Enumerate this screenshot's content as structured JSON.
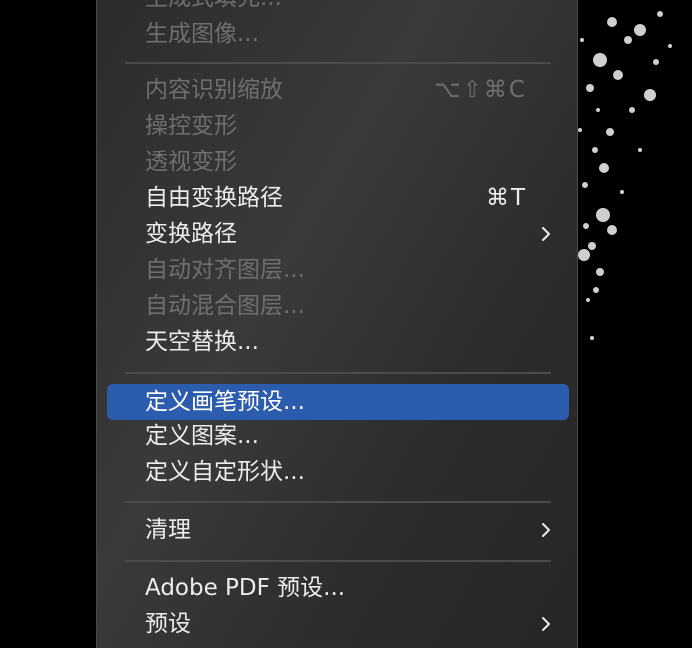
{
  "menu": {
    "items": [
      {
        "label": "生成式填充...",
        "disabled": true
      },
      {
        "label": "生成图像...",
        "disabled": true
      },
      {
        "label": "内容识别缩放",
        "shortcut": "⌥⇧⌘C",
        "disabled": true
      },
      {
        "label": "操控变形",
        "disabled": true
      },
      {
        "label": "透视变形",
        "disabled": true
      },
      {
        "label": "自由变换路径",
        "shortcut": "⌘T",
        "disabled": false
      },
      {
        "label": "变换路径",
        "submenu": true,
        "disabled": false
      },
      {
        "label": "自动对齐图层...",
        "disabled": true
      },
      {
        "label": "自动混合图层...",
        "disabled": true
      },
      {
        "label": "天空替换...",
        "disabled": false
      },
      {
        "label": "定义画笔预设...",
        "disabled": false,
        "selected": true
      },
      {
        "label": "定义图案...",
        "disabled": false
      },
      {
        "label": "定义自定形状...",
        "disabled": false
      },
      {
        "label": "清理",
        "submenu": true,
        "disabled": false
      },
      {
        "label": "Adobe PDF 预设...",
        "disabled": false
      },
      {
        "label": "预设",
        "submenu": true,
        "disabled": false
      }
    ]
  },
  "colors": {
    "menu_bg": "#2f2f2f",
    "selected": "#2c5cae",
    "text": "#ececec",
    "disabled_text": "#6f6f6f",
    "separator": "#4b4b4b"
  },
  "icons": {
    "submenu": "chevron-right-icon"
  }
}
